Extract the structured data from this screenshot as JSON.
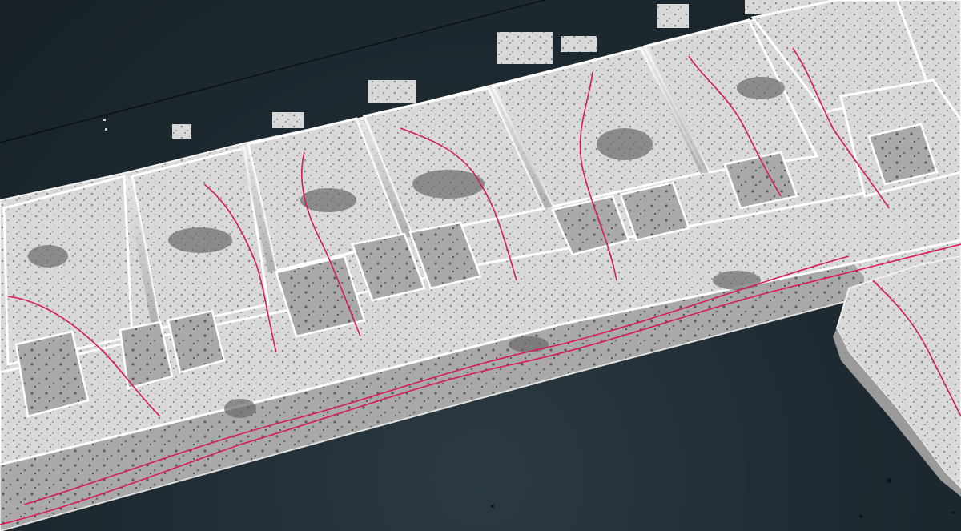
{
  "viewer": {
    "background_color": "#1f2a30",
    "cloud_color": "#e8e8e8",
    "shadow_color": "#5a5f63",
    "trajectory_color": "#d81b55",
    "axis_line_color": "#0a0f12"
  },
  "scene": {
    "subject": "point-cloud-floor-plan-with-trajectory",
    "outer_shell": "building-footprint",
    "corridor": "long-hallway",
    "rooms": [
      "room-1",
      "room-2",
      "room-3",
      "room-4",
      "room-5",
      "room-6",
      "room-7",
      "room-8"
    ],
    "small_rooms": [
      "office-1",
      "office-2",
      "office-3",
      "office-4",
      "office-5",
      "office-6",
      "office-7",
      "office-8",
      "office-9",
      "office-10"
    ],
    "trajectories": [
      "trajectory-main",
      "trajectory-room-1",
      "trajectory-room-2",
      "trajectory-room-3",
      "trajectory-room-4",
      "trajectory-room-5",
      "trajectory-room-6",
      "trajectory-room-7"
    ]
  }
}
